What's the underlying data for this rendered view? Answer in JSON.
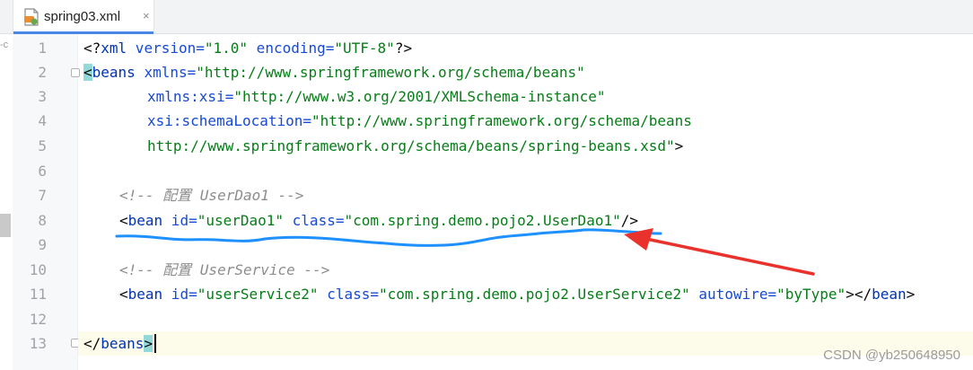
{
  "tab": {
    "filename": "spring03.xml",
    "close_symbol": "×",
    "icon": "xml-file-icon"
  },
  "left_edge_fragment": "-c",
  "line_numbers": [
    "1",
    "2",
    "3",
    "4",
    "5",
    "6",
    "7",
    "8",
    "9",
    "10",
    "11",
    "12",
    "13"
  ],
  "code": {
    "l1": {
      "open": "<?",
      "tag": "xml",
      "a1": " version=",
      "v1": "\"1.0\"",
      "a2": " encoding=",
      "v2": "\"UTF-8\"",
      "close": "?>"
    },
    "l2": {
      "open": "<",
      "tag": "beans",
      "attr": " xmlns=",
      "val": "\"http://www.springframework.org/schema/beans\""
    },
    "l3": {
      "attr": "xmlns:xsi=",
      "val": "\"http://www.w3.org/2001/XMLSchema-instance\""
    },
    "l4": {
      "attr": "xsi:schemaLocation=",
      "val": "\"http://www.springframework.org/schema/beans"
    },
    "l5": {
      "val": "http://www.springframework.org/schema/beans/spring-beans.xsd\"",
      "close": ">"
    },
    "l7": {
      "comment": "<!-- 配置 UserDao1 -->"
    },
    "l8": {
      "open": "<",
      "tag": "bean",
      "a1": " id=",
      "v1": "\"userDao1\"",
      "a2": " class=",
      "v2": "\"com.spring.demo.pojo2.UserDao1\"",
      "close": "/>"
    },
    "l10": {
      "comment": "<!-- 配置 UserService -->"
    },
    "l11": {
      "open": "<",
      "tag": "bean",
      "a1": " id=",
      "v1": "\"userService2\"",
      "a2": " class=",
      "v2": "\"com.spring.demo.pojo2.UserService2\"",
      "a3": " autowire=",
      "v3": "\"byType\"",
      "gt": ">",
      "end_open": "</",
      "end_tag": "bean",
      "end_close": ">"
    },
    "l13": {
      "open": "</",
      "tag": "beans",
      "close": ">"
    }
  },
  "watermark": "CSDN @yb250648950",
  "colors": {
    "tag": "#0033b3",
    "attribute": "#174ad4",
    "string": "#067d17",
    "comment": "#8c8c8c",
    "annotation_underline": "#1e90ff",
    "annotation_arrow": "#e8322b"
  }
}
